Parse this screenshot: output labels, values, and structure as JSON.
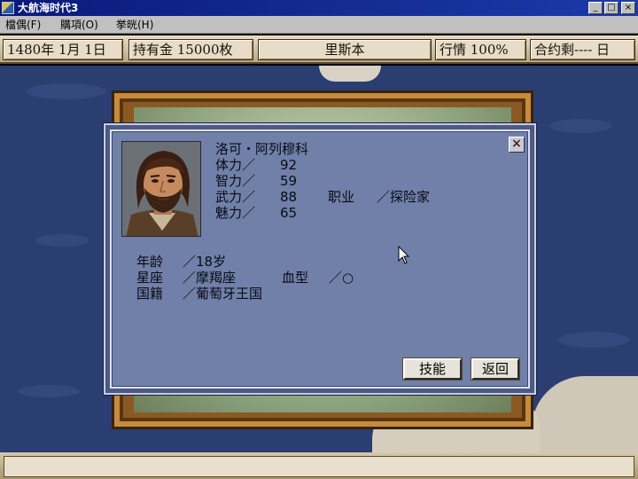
{
  "window": {
    "title": "大航海时代3",
    "min_label": "_",
    "max_label": "□",
    "close_label": "×"
  },
  "menu": {
    "items": [
      "檔偶(F)",
      "購項(O)",
      "挙晄(H)"
    ]
  },
  "status": {
    "date": "1480年  1月  1日",
    "gold": "持有金  15000枚",
    "city": "里斯本",
    "market": "行情  100%",
    "contract": "合约剩---- 日"
  },
  "character": {
    "name": "洛可・阿列穆科",
    "stats": [
      {
        "label": "体力／",
        "value": "92"
      },
      {
        "label": "智力／",
        "value": "59"
      },
      {
        "label": "武力／",
        "value": "88"
      },
      {
        "label": "魅力／",
        "value": "65"
      }
    ],
    "job_label": "职业",
    "job_value": "／探险家",
    "age_label": "年龄",
    "age_value": "／18岁",
    "sign_label": "星座",
    "sign_value": "／摩羯座",
    "blood_label": "血型",
    "blood_value": "／○",
    "nation_label": "国籍",
    "nation_value": "／葡萄牙王国"
  },
  "dialog": {
    "close_label": "×",
    "skills_button": "技能",
    "back_button": "返回"
  },
  "icons": {
    "portrait": "character-portrait",
    "cursor": "mouse-cursor-icon"
  }
}
